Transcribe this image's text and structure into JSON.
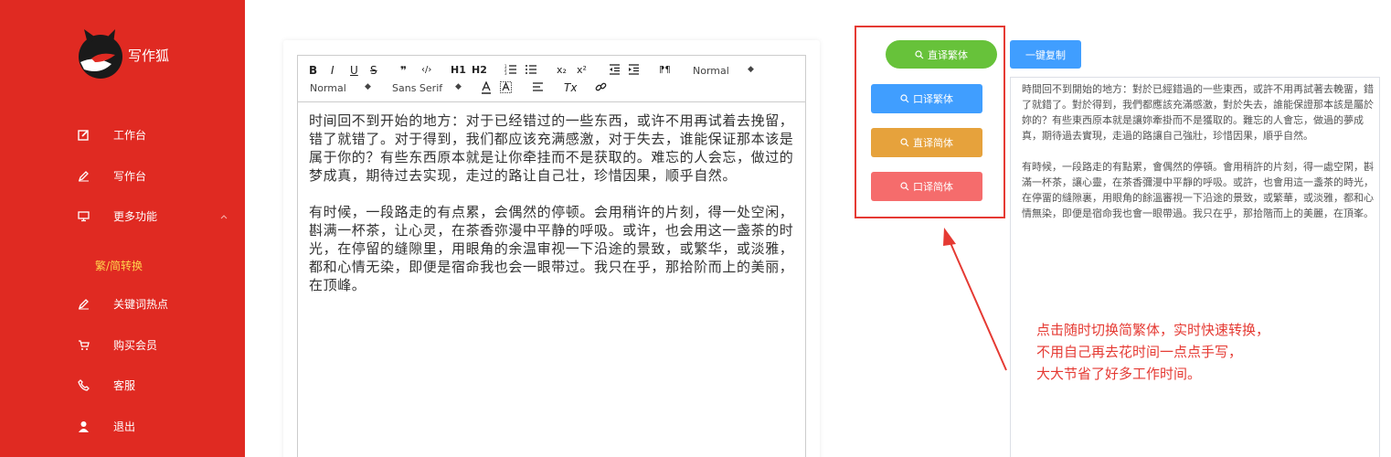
{
  "brand": {
    "name": "写作狐"
  },
  "sidebar": {
    "items": [
      {
        "label": "工作台",
        "icon": "edit-icon"
      },
      {
        "label": "写作台",
        "icon": "pen-icon"
      },
      {
        "label": "更多功能",
        "icon": "monitor-icon"
      },
      {
        "label": "关键词热点",
        "icon": "pen-icon"
      },
      {
        "label": "购买会员",
        "icon": "cart-icon"
      },
      {
        "label": "客服",
        "icon": "phone-icon"
      },
      {
        "label": "退出",
        "icon": "user-icon"
      }
    ],
    "submenu": {
      "label": "繁/简转换",
      "color": "#ffd34d"
    }
  },
  "toolbar": {
    "bold": "B",
    "italic": "I",
    "underline": "U",
    "strike": "S",
    "quote": "❞",
    "code": "‹/›",
    "h1": "H1",
    "h2": "H2",
    "sub": "x₂",
    "sup": "x²",
    "rtl": "⁋¶",
    "size_select": "Normal",
    "header_select": "Normal",
    "font_select": "Sans Serif",
    "clean": "Tx"
  },
  "editor": {
    "paragraphs": [
      "时间回不到开始的地方：对于已经错过的一些东西，或许不用再试着去挽留，错了就错了。对于得到，我们都应该充满感激，对于失去，谁能保证那本该是属于你的？有些东西原本就是让你牵挂而不是获取的。难忘的人会忘，做过的梦成真，期待过去实现，走过的路让自己壮，珍惜因果，顺乎自然。",
      "有时候，一段路走的有点累，会偶然的停顿。会用稍许的片刻，得一处空闲，斟满一杯茶，让心灵，在茶香弥漫中平静的呼吸。或许，也会用这一盏茶的时光，在停留的缝隙里，用眼角的余温审视一下沿途的景致，或繁华，或淡雅，都和心情无染，即便是宿命我也会一眼带过。我只在乎，那拾阶而上的美丽，在顶峰。"
    ]
  },
  "buttons": {
    "direct_traditional": "直译繁体",
    "oral_traditional": "口译繁体",
    "direct_simplified": "直译简体",
    "oral_simplified": "口译简体",
    "copy": "一键复制"
  },
  "output": {
    "paragraphs": [
      "時間回不到開始的地方：對於已經錯過的一些東西，或許不用再試著去輓畱，錯了就錯了。對於得到，我們都應該充滿感激，對於失去，誰能保證那本該是屬於妳的？有些東西原本就是讓妳牽掛而不是獲取的。難忘的人會忘，做過的夢成真，期待過去實現，走過的路讓自己強壯，珍惜因果，順乎自然。",
      "有時候，一段路走的有點累，會偶然的停頓。會用稍許的片刻，得一處空閑，斟滿一杯茶，讓心靈，在茶香彌漫中平靜的呼吸。或許，也會用這一盞茶的時光，在停畱的縫隙裏，用眼角的餘溫審視一下沿途的景致，或繁華，或淡雅，都和心情無染，即便是宿命我也會一眼帶過。我只在乎，那拾階而上的美麗，在頂峯。"
    ]
  },
  "caption": {
    "lines": [
      "点击随时切换简繁体，实时快速转换，",
      "不用自己再去花时间一点点手写，",
      "大大节省了好多工作时间。"
    ]
  },
  "colors": {
    "sidebar": "#e02a22",
    "green": "#67c23a",
    "blue": "#409eff",
    "orange": "#e6a23c",
    "red": "#f56c6c",
    "annotation": "#e53a33"
  }
}
